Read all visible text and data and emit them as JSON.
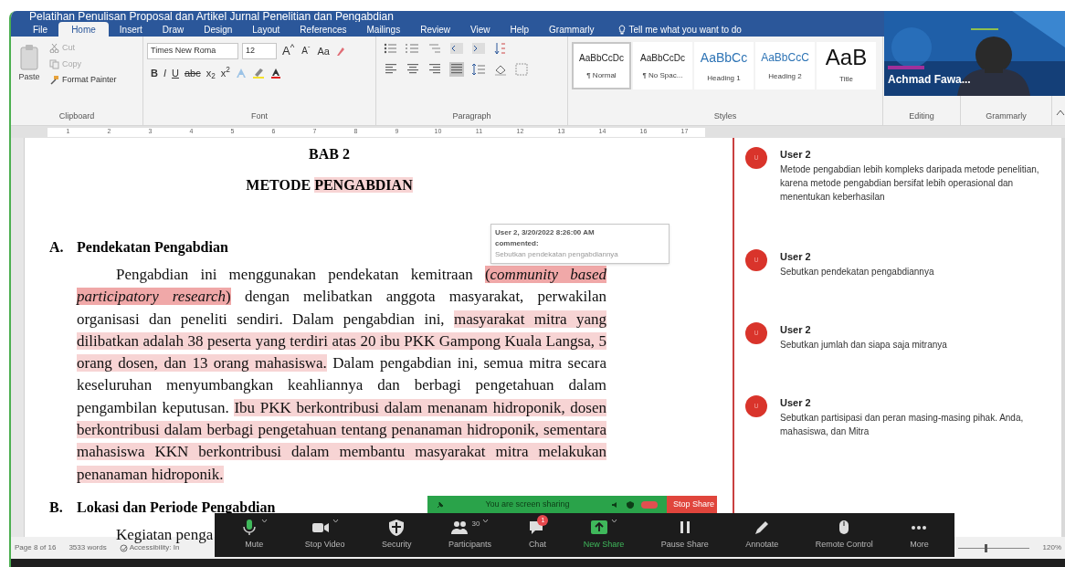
{
  "window": {
    "title": "Pelatihan Penulisan Proposal dan Artikel Jurnal Penelitian dan Pengabdian"
  },
  "ribbon_tabs": [
    {
      "label": "File",
      "selected": false
    },
    {
      "label": "Home",
      "selected": true
    },
    {
      "label": "Insert",
      "selected": false
    },
    {
      "label": "Draw",
      "selected": false
    },
    {
      "label": "Design",
      "selected": false
    },
    {
      "label": "Layout",
      "selected": false
    },
    {
      "label": "References",
      "selected": false
    },
    {
      "label": "Mailings",
      "selected": false
    },
    {
      "label": "Review",
      "selected": false
    },
    {
      "label": "View",
      "selected": false
    },
    {
      "label": "Help",
      "selected": false
    },
    {
      "label": "Grammarly",
      "selected": false
    }
  ],
  "tell_me": {
    "placeholder": "Tell me what you want to do"
  },
  "clipboard": {
    "paste": "Paste",
    "cut": "Cut",
    "copy": "Copy",
    "format_painter": "Format Painter",
    "group": "Clipboard"
  },
  "font": {
    "name": "Times New Roma",
    "size": "12",
    "group": "Font",
    "size_tools": [
      {
        "label": "A$^{^}$",
        "kind": "grow"
      },
      {
        "label": "A$^{ˇ}$",
        "kind": "shrink"
      },
      {
        "label": "Aa",
        "kind": "case"
      }
    ],
    "format_tools": [
      {
        "label": "B",
        "kind": "bold"
      },
      {
        "label": "I",
        "kind": "italic"
      },
      {
        "label": "U",
        "kind": "underline"
      },
      {
        "label": "abc",
        "kind": "strike"
      },
      {
        "label": "x$_{2}$",
        "kind": "sub"
      },
      {
        "label": "x$^{2}$",
        "kind": "sup"
      }
    ]
  },
  "paragraph_group": "Paragraph",
  "styles": {
    "group": "Styles",
    "items": [
      {
        "sample": "AaBbCcDc",
        "label": "¶ Normal",
        "kind": "normal",
        "selected": true
      },
      {
        "sample": "AaBbCcDc",
        "label": "¶ No Spac...",
        "kind": "plain",
        "selected": false
      },
      {
        "sample": "AaBbCc",
        "label": "Heading 1",
        "kind": "heading1",
        "selected": false
      },
      {
        "sample": "AaBbCcC",
        "label": "Heading 2",
        "kind": "heading2",
        "selected": false
      },
      {
        "sample": "AaB",
        "label": "Title",
        "kind": "title",
        "selected": false
      }
    ]
  },
  "editing_group": "Editing",
  "grammarly_group": "Grammarly",
  "ruler": {
    "labels": [
      "1",
      "2",
      "3",
      "4",
      "5",
      "6",
      "7",
      "8",
      "9",
      "10",
      "11",
      "12",
      "13",
      "14",
      "16",
      "17"
    ]
  },
  "document": {
    "chapter": "BAB 2",
    "title": [
      {
        "text": "METODE ",
        "highlighted": false,
        "active": false
      },
      {
        "text": "PENGABDIAN",
        "highlighted": true,
        "active": false
      }
    ],
    "sections": [
      {
        "number": "A.",
        "heading": "Pendekatan Pengabdian",
        "paragraph": [
          {
            "text": "Pengabdian ini menggunakan pendekatan kemitraan ",
            "highlighted": false,
            "active": false
          },
          {
            "text": "(*community based participatory research*)",
            "highlighted": true,
            "active": true
          },
          {
            "text": " dengan melibatkan anggota masyarakat, perwakilan organisasi dan peneliti sendiri. Dalam pengabdian ini, ",
            "highlighted": false,
            "active": false
          },
          {
            "text": "masyarakat mitra yang dilibatkan adalah 38 peserta yang terdiri atas 20 ibu PKK Gampong Kuala Langsa, 5 orang dosen, dan 13 orang mahasiswa.",
            "highlighted": true,
            "active": false
          },
          {
            "text": " Dalam pengabdian ini, semua mitra secara keseluruhan menyumbangkan keahliannya dan berbagi pengetahuan dalam pengambilan keputusan. ",
            "highlighted": false,
            "active": false
          },
          {
            "text": "Ibu PKK berkontribusi dalam menanam hidroponik, dosen berkontribusi dalam berbagi pengetahuan tentang penanaman hidroponik, sementara mahasiswa KKN berkontribusi dalam membantu masyarakat mitra melakukan penanaman hidroponik.",
            "highlighted": true,
            "active": false
          }
        ]
      },
      {
        "number": "B.",
        "heading": "Lokasi dan Periode Pengabdian",
        "paragraph": [
          {
            "text": "Kegiatan penga",
            "highlighted": false,
            "active": false
          }
        ]
      }
    ]
  },
  "comment_tooltip": {
    "header": "User 2, 3/20/2022 8:26:00 AM",
    "action": "commented:",
    "text": "Sebutkan pendekatan pengabdiannya"
  },
  "comments": [
    {
      "avatar": "U",
      "author": "User 2",
      "text": "Metode pengabdian lebih kompleks daripada metode penelitian, karena metode pengabdian bersifat lebih operasional dan menentukan keberhasilan"
    },
    {
      "avatar": "U",
      "author": "User 2",
      "text": "Sebutkan pendekatan pengabdiannya"
    },
    {
      "avatar": "U",
      "author": "User 2",
      "text": "Sebutkan jumlah dan siapa saja mitranya"
    },
    {
      "avatar": "U",
      "author": "User 2",
      "text": "Sebutkan partisipasi dan peran masing-masing pihak. Anda, mahasiswa, dan Mitra"
    }
  ],
  "status_bar": {
    "page": "Page 8 of 16",
    "words": "3533 words",
    "accessibility": "Accessibility: In",
    "zoom": "120%"
  },
  "video": {
    "name": "Achmad Fawa..."
  },
  "share_bar": {
    "message": "You are screen sharing",
    "stop": "Stop Share"
  },
  "meeting_controls": [
    {
      "label": "Mute",
      "kind": "mic"
    },
    {
      "label": "Stop Video",
      "kind": "video"
    },
    {
      "label": "Security",
      "kind": "security"
    },
    {
      "label": "Participants",
      "kind": "participants",
      "count": "30"
    },
    {
      "label": "Chat",
      "kind": "chat",
      "badge": "1"
    },
    {
      "label": "New Share",
      "kind": "share"
    },
    {
      "label": "Pause Share",
      "kind": "pause"
    },
    {
      "label": "Annotate",
      "kind": "annotate"
    },
    {
      "label": "Remote Control",
      "kind": "remote"
    },
    {
      "label": "More",
      "kind": "more"
    }
  ]
}
